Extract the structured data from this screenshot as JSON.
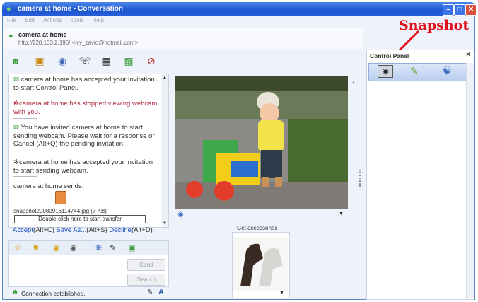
{
  "window": {
    "title": "camera at home - Conversation"
  },
  "menu": [
    "File",
    "Edit",
    "Actions",
    "Tools",
    "Help"
  ],
  "contact": {
    "name": "camera at home",
    "address": "http://220.133.2.196/ <ivy_zavio@hotmail.com>"
  },
  "chat": {
    "messages": [
      {
        "text": "camera at home has accepted your invitation to start Control Panel.",
        "style": "normal"
      },
      {
        "text": "camera at home has stopped viewing webcam with you.",
        "style": "red"
      },
      {
        "text": "You have invited camera at home to start sending webcam. Please wait for a response or Cancel (Alt+Q) the pending invitation.",
        "style": "normal"
      },
      {
        "text": "camera at home has accepted your invitation to start sending webcam.",
        "style": "normal"
      }
    ],
    "sends_label": "camera at home sends:",
    "file_name": "snapshot20080916114744.jpg (7 KB)",
    "transfer_hint": "Double-click here to start transfer",
    "accept_label": "Accept",
    "accept_key": "(Alt+C)",
    "saveas_label": "Save As...",
    "saveas_key": "(Alt+S)",
    "decline_label": "Decline",
    "decline_key": "(Alt+D)"
  },
  "compose": {
    "send_label": "Send",
    "search_label": "Search"
  },
  "status": {
    "text": "Connection established."
  },
  "accessories": {
    "label": "Get accessories"
  },
  "control_panel": {
    "title": "Control Panel",
    "close": "×"
  },
  "annotation": {
    "label": "Snapshot",
    "color": "#e2101a"
  },
  "colors": {
    "titlebar": "#1c55d0",
    "link": "#1d4fb8",
    "alert": "#b0263c"
  }
}
